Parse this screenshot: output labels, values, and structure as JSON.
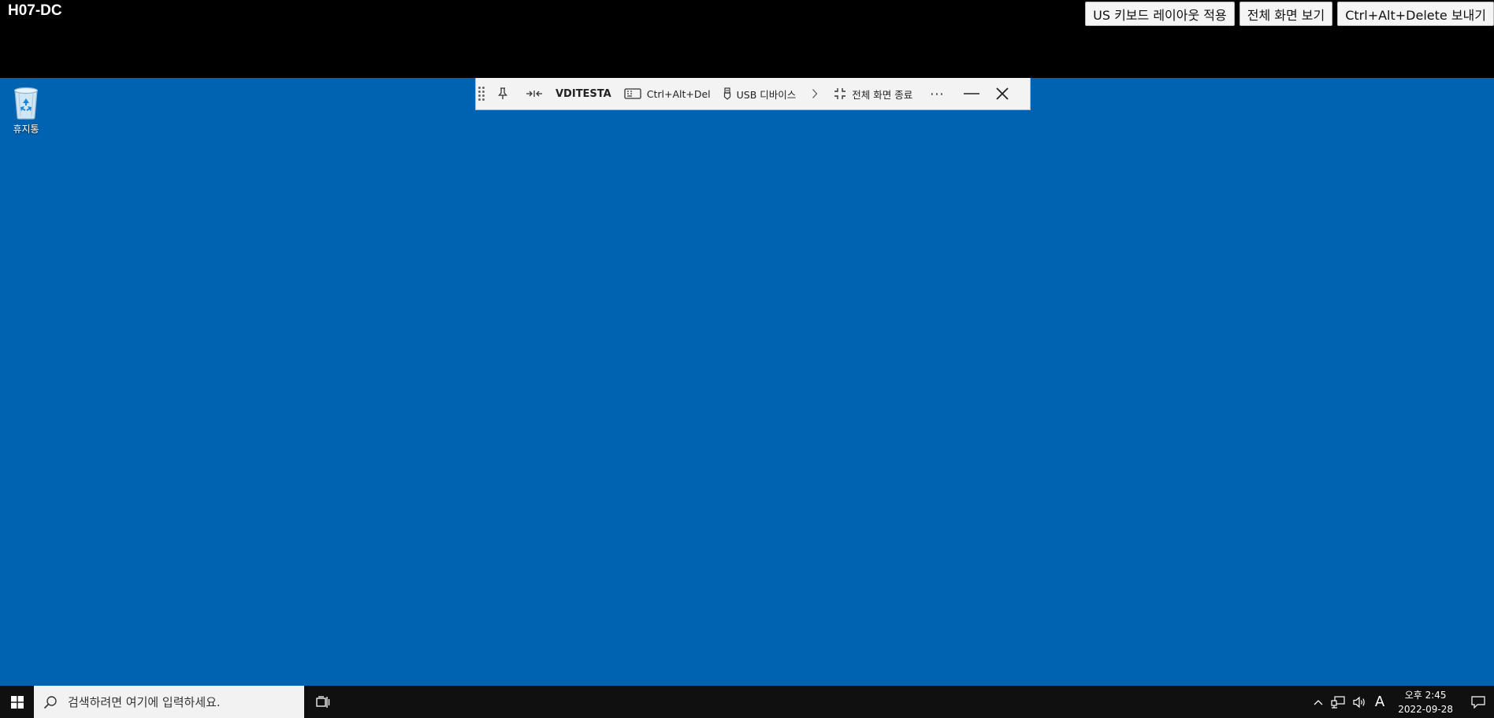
{
  "console": {
    "host_title": "H07-DC",
    "buttons": {
      "keyboard_layout": "US 키보드 레이아웃 적용",
      "fullscreen": "전체 화면 보기",
      "ctrl_alt_delete": "Ctrl+Alt+Delete 보내기"
    }
  },
  "desktop": {
    "background_color": "#0063b1",
    "icons": [
      {
        "label": "휴지통",
        "icon": "recycle-bin-icon"
      }
    ]
  },
  "rdp_toolbar": {
    "connection_name": "VDITESTA",
    "ctrl_alt_del_label": "Ctrl+Alt+Del",
    "usb_label": "USB 디바이스",
    "exit_fullscreen_label": "전체 화면 종료",
    "more_label": "···"
  },
  "taskbar": {
    "search_placeholder": "검색하려면 여기에 입력하세요.",
    "ime_label": "A",
    "clock_time": "오후 2:45",
    "clock_date": "2022-09-28"
  }
}
